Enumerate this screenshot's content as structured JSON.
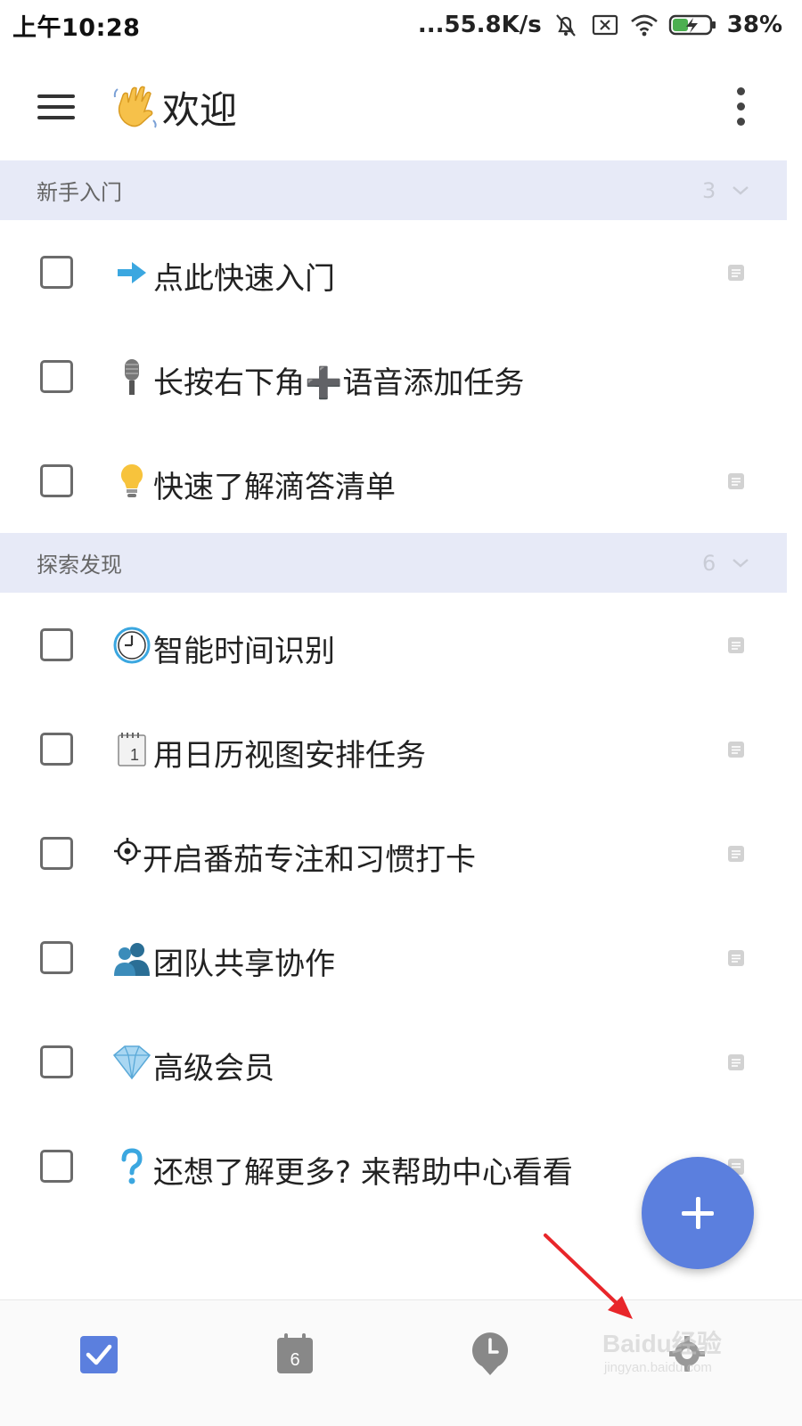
{
  "status_bar": {
    "time": "上午10:28",
    "network_speed": "...55.8K/s",
    "battery_percent": "38%",
    "icons": [
      "bell-muted-icon",
      "sim-x-icon",
      "wifi-icon",
      "battery-charging-icon"
    ]
  },
  "toolbar": {
    "title": "欢迎",
    "title_emoji": "waving-hand-icon",
    "menu_icon": "hamburger-icon",
    "more_icon": "more-vertical-icon"
  },
  "sections": [
    {
      "title": "新手入门",
      "count": "3",
      "tasks": [
        {
          "label": "点此快速入门",
          "emoji": "right-arrow-icon",
          "has_note": true
        },
        {
          "label": "长按右下角➕语音添加任务",
          "emoji": "microphone-icon",
          "has_note": false
        },
        {
          "label": "快速了解滴答清单",
          "emoji": "light-bulb-icon",
          "has_note": true
        }
      ]
    },
    {
      "title": "探索发现",
      "count": "6",
      "tasks": [
        {
          "label": "智能时间识别",
          "emoji": "clock-icon",
          "has_note": true
        },
        {
          "label": "用日历视图安排任务",
          "emoji": "calendar-pad-icon",
          "has_note": true
        },
        {
          "label": "开启番茄专注和习惯打卡",
          "emoji": "gear-sun-icon",
          "has_note": true
        },
        {
          "label": "团队共享协作",
          "emoji": "users-icon",
          "has_note": true
        },
        {
          "label": "高级会员",
          "emoji": "diamond-icon",
          "has_note": true
        },
        {
          "label": "还想了解更多? 来帮助中心看看",
          "emoji": "question-mark-icon",
          "has_note": true
        }
      ]
    }
  ],
  "fab": {
    "icon": "plus-icon"
  },
  "bottom_nav": {
    "tabs": [
      {
        "name": "tasks",
        "icon": "checkbox-checked-icon",
        "active": true
      },
      {
        "name": "calendar",
        "icon": "calendar-icon",
        "text": "6",
        "active": false
      },
      {
        "name": "pomodoro",
        "icon": "clock-pin-icon",
        "active": false
      },
      {
        "name": "settings",
        "icon": "gear-icon",
        "active": false
      }
    ]
  },
  "watermark": {
    "brand": "Baidu经验",
    "url": "jingyan.baidu.com"
  },
  "colors": {
    "accent": "#5b7fde",
    "section_bg": "#e7eaf7",
    "annotation_arrow": "#e8262a"
  }
}
